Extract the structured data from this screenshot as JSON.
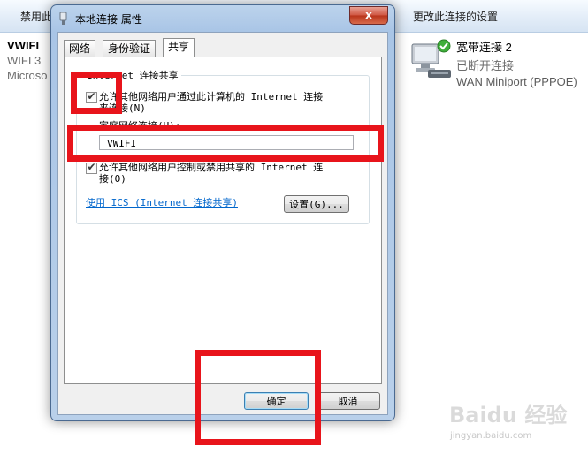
{
  "background": {
    "toolbar": {
      "disable_label": "禁用此",
      "change_settings_label": "更改此连接的设置"
    },
    "connection_left": {
      "name": "VWIFI",
      "status": "WIFI  3",
      "device": "Microso"
    },
    "connection_right": {
      "name": "宽带连接 2",
      "status": "已断开连接",
      "device": "WAN Miniport (PPPOE)"
    }
  },
  "dialog": {
    "title": "本地连接 属性",
    "close_label": "x",
    "tabs": [
      {
        "label": "网络"
      },
      {
        "label": "身份验证"
      },
      {
        "label": "共享"
      }
    ],
    "group_title": "Internet 连接共享",
    "allow_share": {
      "checked": true,
      "label_line1": "允许其他网络用户通过此计算机的 Internet 连接",
      "label_line2": "来连接(N)"
    },
    "home_network": {
      "label": "家庭网络连接(H):",
      "value": "VWIFI"
    },
    "allow_control": {
      "checked": true,
      "label_line1": "允许其他网络用户控制或禁用共享的 Internet 连",
      "label_line2": "接(O)"
    },
    "ics_link": "使用 ICS (Internet 连接共享)",
    "settings_button": "设置(G)...",
    "ok_button": "确定",
    "cancel_button": "取消"
  },
  "watermark": {
    "text": "Baidu 经验",
    "url": "jingyan.baidu.com"
  },
  "colors": {
    "annotation_red": "#e8141b",
    "link_blue": "#0066cc"
  }
}
